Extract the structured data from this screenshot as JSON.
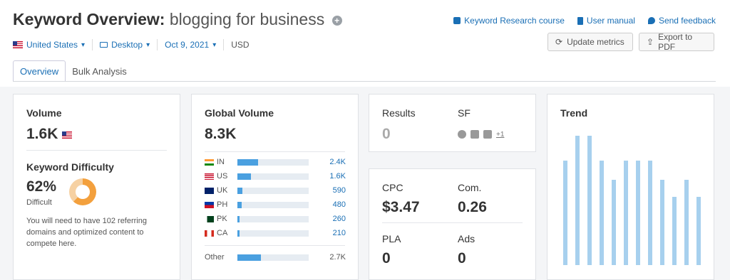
{
  "header": {
    "title_prefix": "Keyword Overview:",
    "keyword": "blogging for business",
    "links": [
      "Keyword Research course",
      "User manual",
      "Send feedback"
    ],
    "filters": {
      "country": "United States",
      "device": "Desktop",
      "date": "Oct 9, 2021",
      "currency": "USD"
    },
    "update_label": "Update metrics",
    "export_label": "Export to PDF",
    "tabs": [
      "Overview",
      "Bulk Analysis"
    ]
  },
  "volume": {
    "label": "Volume",
    "value": "1.6K",
    "kd_label": "Keyword Difficulty",
    "kd_value": "62%",
    "kd_level": "Difficult",
    "kd_percent": 62,
    "kd_note": "You will need to have 102 referring domains and optimized content to compete here."
  },
  "global": {
    "label": "Global Volume",
    "value": "8.3K",
    "rows": [
      {
        "code": "IN",
        "value": "2.4K",
        "share": 0.29
      },
      {
        "code": "US",
        "value": "1.6K",
        "share": 0.19
      },
      {
        "code": "UK",
        "value": "590",
        "share": 0.07
      },
      {
        "code": "PH",
        "value": "480",
        "share": 0.06
      },
      {
        "code": "PK",
        "value": "260",
        "share": 0.03
      },
      {
        "code": "CA",
        "value": "210",
        "share": 0.03
      }
    ],
    "other_label": "Other",
    "other_value": "2.7K",
    "other_share": 0.33
  },
  "results": {
    "results_label": "Results",
    "results_value": "0",
    "sf_label": "SF",
    "sf_more": "+1"
  },
  "metrics": {
    "cpc_label": "CPC",
    "cpc_value": "$3.47",
    "com_label": "Com.",
    "com_value": "0.26",
    "pla_label": "PLA",
    "pla_value": "0",
    "ads_label": "Ads",
    "ads_value": "0"
  },
  "trend": {
    "label": "Trend",
    "values": [
      0.81,
      1.0,
      1.0,
      0.81,
      0.66,
      0.81,
      0.81,
      0.81,
      0.66,
      0.53,
      0.66,
      0.53
    ]
  }
}
